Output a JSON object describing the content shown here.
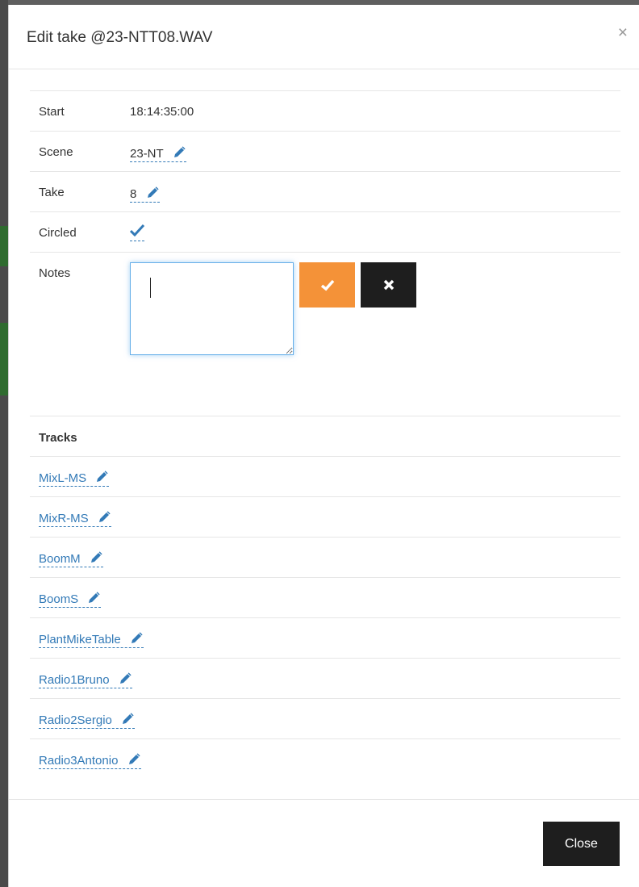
{
  "dialog": {
    "title": "Edit take @23-NTT08.WAV",
    "close_symbol": "×"
  },
  "fields": {
    "start": {
      "label": "Start",
      "value": "18:14:35:00"
    },
    "scene": {
      "label": "Scene",
      "value": "23-NT"
    },
    "take": {
      "label": "Take",
      "value": "8"
    },
    "circled": {
      "label": "Circled",
      "checked": true
    },
    "notes": {
      "label": "Notes",
      "value": ""
    }
  },
  "tracks": {
    "heading": "Tracks",
    "items": [
      "MixL-MS",
      "MixR-MS",
      "BoomM",
      "BoomS",
      "PlantMikeTable",
      "Radio1Bruno",
      "Radio2Sergio",
      "Radio3Antonio"
    ]
  },
  "footer": {
    "close_label": "Close"
  },
  "colors": {
    "link": "#337ab7",
    "ok_button": "#f49238",
    "dark_button": "#1e1e1e"
  },
  "icons": {
    "edit": "pencil-icon",
    "check": "check-icon",
    "cancel": "x-icon"
  }
}
